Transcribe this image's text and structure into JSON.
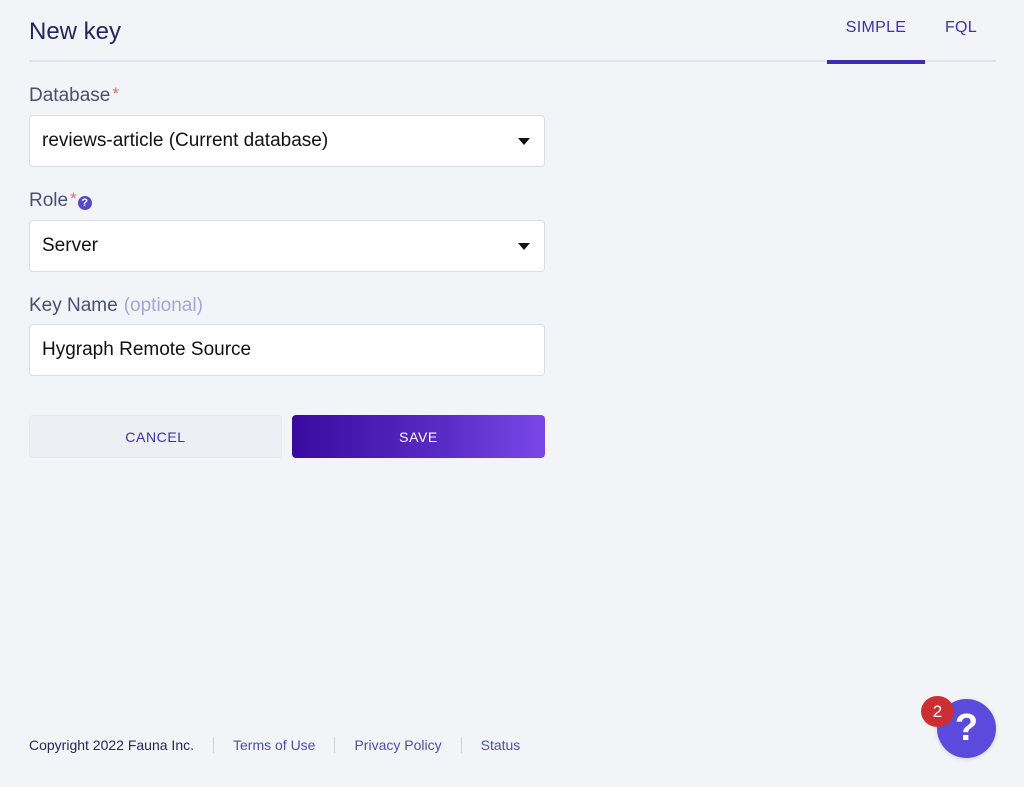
{
  "header": {
    "title": "New key",
    "tabs": [
      {
        "label": "SIMPLE",
        "active": true
      },
      {
        "label": "FQL",
        "active": false
      }
    ]
  },
  "form": {
    "database": {
      "label": "Database",
      "required_mark": "*",
      "selected_value": "reviews-article (Current database)"
    },
    "role": {
      "label": "Role",
      "required_mark": "*",
      "help_icon": "?",
      "selected_value": "Server"
    },
    "key_name": {
      "label": "Key Name",
      "optional_hint": "(optional)",
      "value": "Hygraph Remote Source"
    },
    "buttons": {
      "cancel": "CANCEL",
      "save": "SAVE"
    }
  },
  "footer": {
    "copyright": "Copyright 2022 Fauna Inc.",
    "links": [
      "Terms of Use",
      "Privacy Policy",
      "Status"
    ]
  },
  "help_widget": {
    "icon": "?",
    "badge_count": "2"
  },
  "colors": {
    "accent": "#3f2bb3",
    "required": "#e86a6a",
    "badge": "#cc2f33",
    "help_button": "#5b4bdc"
  }
}
